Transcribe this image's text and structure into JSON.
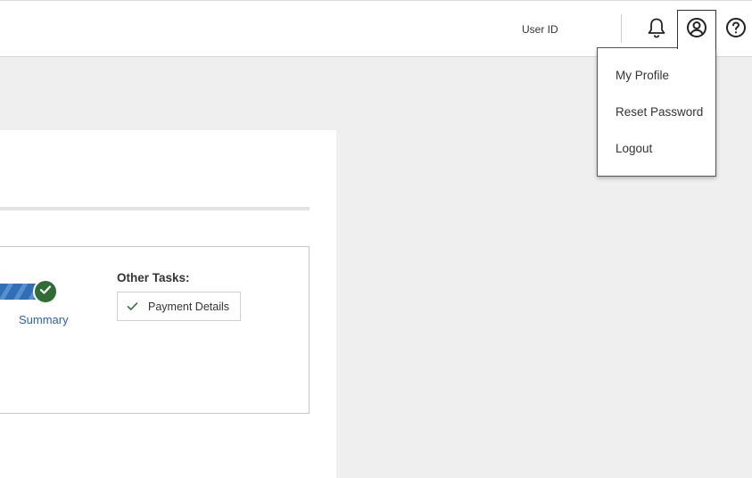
{
  "header": {
    "user_id_label": "User ID",
    "icons": {
      "notifications": "bell-icon",
      "profile": "user-circle-icon",
      "help": "question-circle-icon"
    }
  },
  "profile_menu": {
    "items": [
      {
        "label": "My Profile"
      },
      {
        "label": "Reset Password"
      },
      {
        "label": "Logout"
      }
    ]
  },
  "tasks": {
    "current_step_label": "Summary",
    "current_step_status": "complete",
    "other_tasks_label": "Other Tasks:",
    "other_tasks": [
      {
        "label": "Payment Details",
        "status": "complete"
      }
    ]
  },
  "colors": {
    "accent_blue": "#2f6fb5",
    "link_blue": "#2b63a8",
    "success_green": "#2f6d35",
    "background": "#efefef"
  }
}
